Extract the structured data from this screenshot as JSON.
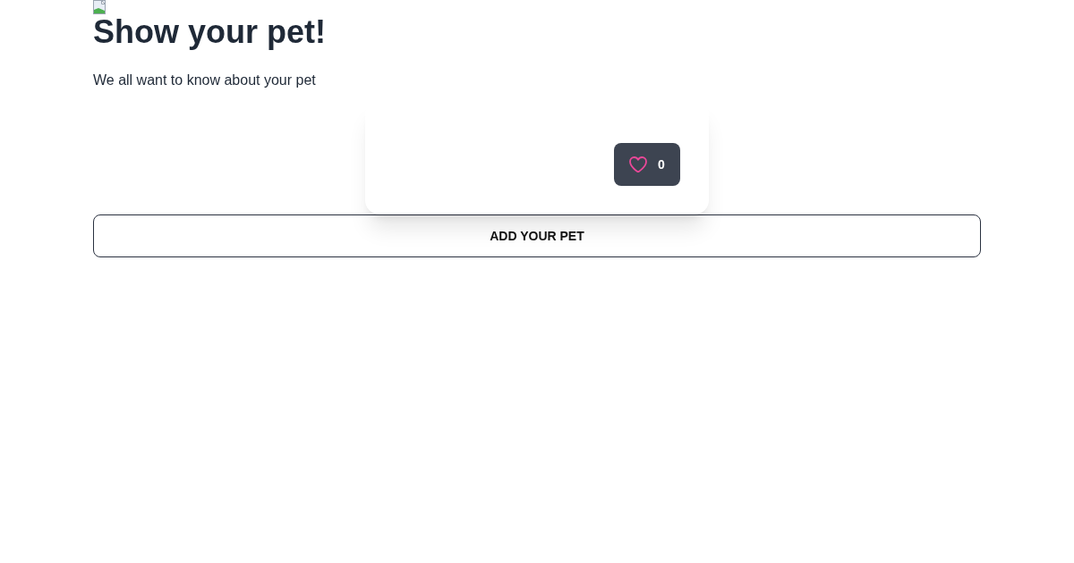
{
  "page": {
    "title": "Show your pet!",
    "subtitle": "We all want to know about your pet"
  },
  "pets": [
    {
      "likes": "0"
    }
  ],
  "add_button": {
    "label": "ADD YOUR PET"
  }
}
